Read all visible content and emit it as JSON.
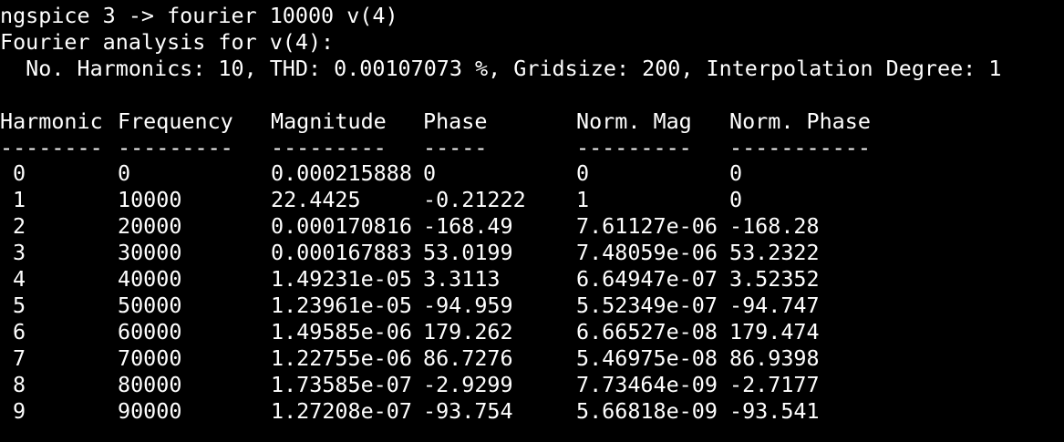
{
  "terminal": {
    "prompt_line": "ngspice 3 -> fourier 10000 v(4)",
    "title_line": "Fourier analysis for v(4):",
    "params_line": "  No. Harmonics: 10, THD: 0.00107073 %, Gridsize: 200, Interpolation Degree: 1"
  },
  "table": {
    "headers": [
      "Harmonic",
      "Frequency",
      "Magnitude",
      "Phase",
      "Norm. Mag",
      "Norm. Phase"
    ],
    "dashes": [
      "--------",
      "---------",
      "---------",
      "-----",
      "---------",
      "-----------"
    ],
    "rows": [
      [
        "0",
        "0",
        "0.000215888",
        "0",
        "0",
        "0"
      ],
      [
        "1",
        "10000",
        "22.4425",
        "-0.21222",
        "1",
        "0"
      ],
      [
        "2",
        "20000",
        "0.000170816",
        "-168.49",
        "7.61127e-06",
        "-168.28"
      ],
      [
        "3",
        "30000",
        "0.000167883",
        "53.0199",
        "7.48059e-06",
        "53.2322"
      ],
      [
        "4",
        "40000",
        "1.49231e-05",
        "3.3113",
        "6.64947e-07",
        "3.52352"
      ],
      [
        "5",
        "50000",
        "1.23961e-05",
        "-94.959",
        "5.52349e-07",
        "-94.747"
      ],
      [
        "6",
        "60000",
        "1.49585e-06",
        "179.262",
        "6.66527e-08",
        "179.474"
      ],
      [
        "7",
        "70000",
        "1.22755e-06",
        "86.7276",
        "5.46975e-08",
        "86.9398"
      ],
      [
        "8",
        "80000",
        "1.73585e-07",
        "-2.9299",
        "7.73464e-09",
        "-2.7177"
      ],
      [
        "9",
        "90000",
        "1.27208e-07",
        "-93.754",
        "5.66818e-09",
        "-93.541"
      ]
    ]
  },
  "colors": {
    "background": "#000000",
    "foreground": "#ffffff"
  }
}
